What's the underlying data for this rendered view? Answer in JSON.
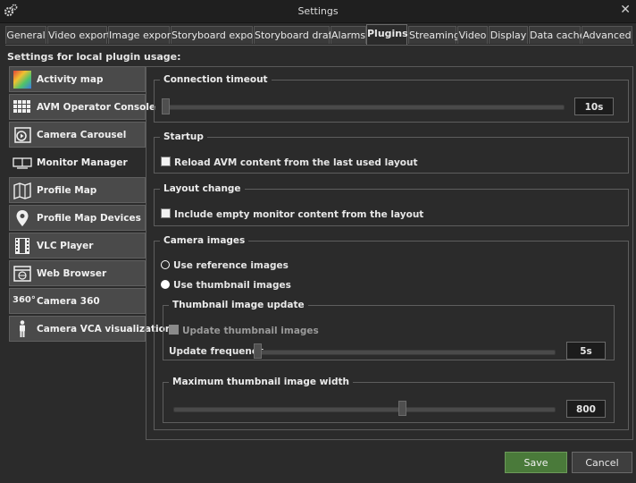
{
  "window": {
    "title": "Settings",
    "close_glyph": "✕"
  },
  "tabs": [
    {
      "label": "General"
    },
    {
      "label": "Video export"
    },
    {
      "label": "Image export"
    },
    {
      "label": "Storyboard export"
    },
    {
      "label": "Storyboard draft"
    },
    {
      "label": "Alarms"
    },
    {
      "label": "Plugins",
      "active": true
    },
    {
      "label": "Streaming"
    },
    {
      "label": "Video"
    },
    {
      "label": "Display"
    },
    {
      "label": "Data cache"
    },
    {
      "label": "Advanced"
    }
  ],
  "plugins_header": "Settings for local plugin usage:",
  "plugins": [
    {
      "label": "Activity map",
      "icon": "activity-map-icon"
    },
    {
      "label": "AVM Operator Console",
      "icon": "grid-icon"
    },
    {
      "label": "Camera Carousel",
      "icon": "carousel-icon"
    },
    {
      "label": "Monitor Manager",
      "icon": "monitor-icon",
      "active": true
    },
    {
      "label": "Profile Map",
      "icon": "map-icon"
    },
    {
      "label": "Profile Map Devices",
      "icon": "map-pin-icon"
    },
    {
      "label": "VLC Player",
      "icon": "film-icon"
    },
    {
      "label": "Web Browser",
      "icon": "web-icon"
    },
    {
      "label": "Camera 360",
      "icon": "360-icon",
      "icon_text": "360°"
    },
    {
      "label": "Camera VCA visualization",
      "icon": "person-icon"
    }
  ],
  "connection_timeout": {
    "legend": "Connection timeout",
    "value": "10s",
    "slider_fraction": 0.0
  },
  "startup": {
    "legend": "Startup",
    "checkbox_label": "Reload AVM content from the last used layout",
    "checked": false
  },
  "layout_change": {
    "legend": "Layout change",
    "checkbox_label": "Include empty monitor content from the layout",
    "checked": false
  },
  "camera_images": {
    "legend": "Camera images",
    "radio_reference": "Use reference images",
    "radio_thumbnail": "Use thumbnail images",
    "selected": "thumbnail",
    "thumbnail_update": {
      "legend": "Thumbnail image update",
      "checkbox_label": "Update thumbnail images",
      "checked": false,
      "disabled": true,
      "frequency_label": "Update frequency",
      "frequency_value": "5s",
      "frequency_fraction": 0.0
    },
    "max_width": {
      "legend": "Maximum thumbnail image width",
      "value": "800",
      "slider_fraction": 0.6
    }
  },
  "buttons": {
    "save": "Save",
    "cancel": "Cancel"
  },
  "colors": {
    "save_green": "#4a7a3a",
    "window_bg": "#2b2b2b"
  }
}
